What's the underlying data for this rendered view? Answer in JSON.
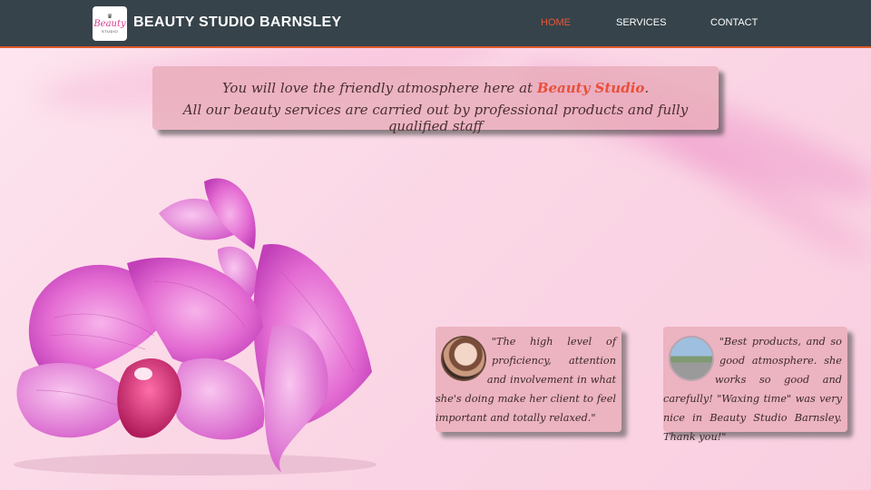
{
  "header": {
    "logo": {
      "crown_icon": "crown-icon",
      "script": "Beauty",
      "sub": "STUDIO"
    },
    "brand": "BEAUTY STUDIO BARNSLEY",
    "nav": [
      {
        "label": "HOME",
        "active": true
      },
      {
        "label": "SERVICES",
        "active": false
      },
      {
        "label": "CONTACT",
        "active": false
      }
    ],
    "accent_color": "#e8563a",
    "bar_color": "#36434a"
  },
  "banner": {
    "line1_before": "You will love the friendly atmosphere here at ",
    "line1_accent": "Beauty Studio",
    "line1_after": ".",
    "line2": "All our beauty services are carried out by professional products and fully qualified staff"
  },
  "hero_image": {
    "icon": "orchid-flower-image"
  },
  "testimonials": [
    {
      "avatar_icon": "mother-and-baby-photo",
      "text": "\"The high level of proficiency, attention and involvement in what she's doing make her client to feel important and totally relaxed.\""
    },
    {
      "avatar_icon": "person-on-road-photo",
      "text": "\"Best products, and so good atmosphere. she works so good and carefully! \"Waxing time\" was very nice in Beauty Studio Barnsley. Thank you!\""
    }
  ]
}
